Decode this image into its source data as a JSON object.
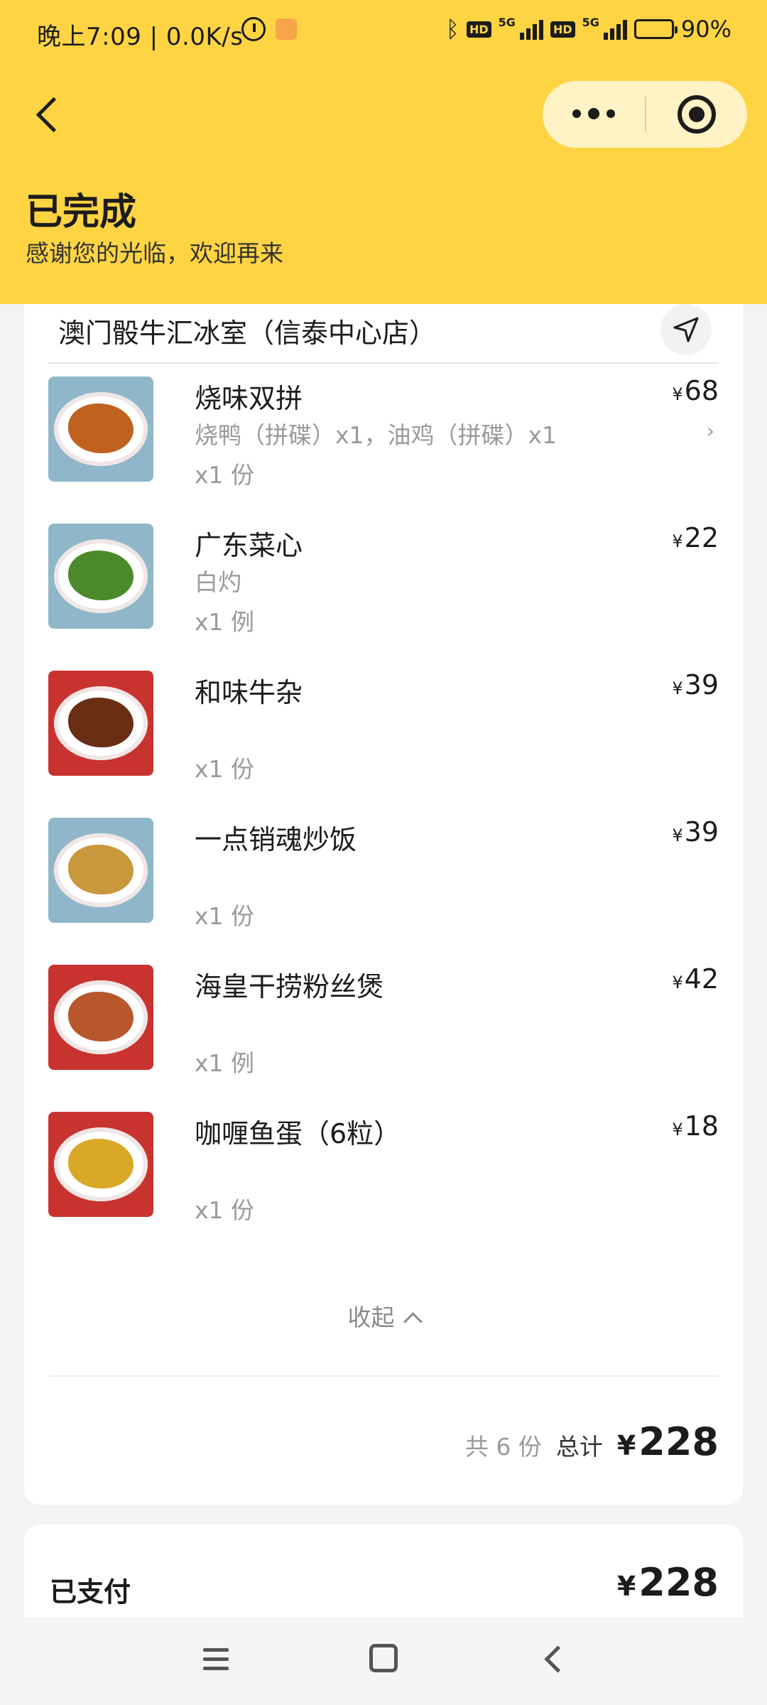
{
  "status_bar": {
    "time_speed": "晚上7:09 | 0.0K/s",
    "hd_badge": "HD",
    "network": "5G",
    "battery_percent": "90%",
    "battery_level": 0.9
  },
  "header": {
    "title": "已完成",
    "subtitle": "感谢您的光临，欢迎再来"
  },
  "order": {
    "shop_name": "澳门骰牛汇冰室（信泰中心店）",
    "currency": "¥",
    "items": [
      {
        "name": "烧味双拼",
        "spec": "烧鸭（拼碟）x1，油鸡（拼碟）x1",
        "qty": "x1 份",
        "price": "68",
        "color": "#c0621f"
      },
      {
        "name": "广东菜心",
        "spec": "白灼",
        "qty": "x1 例",
        "price": "22",
        "color": "#4b8a2c"
      },
      {
        "name": "和味牛杂",
        "spec": "",
        "qty": "x1 份",
        "price": "39",
        "color": "#6a2e14"
      },
      {
        "name": "一点销魂炒饭",
        "spec": "",
        "qty": "x1 份",
        "price": "39",
        "color": "#c9973c"
      },
      {
        "name": "海皇干捞粉丝煲",
        "spec": "",
        "qty": "x1 例",
        "price": "42",
        "color": "#b8562c"
      },
      {
        "name": "咖喱鱼蛋（6粒）",
        "spec": "",
        "qty": "x1 份",
        "price": "18",
        "color": "#d9a826"
      }
    ],
    "collapse_label": "收起",
    "count_label": "共 6 份",
    "total_label": "总计",
    "total": "228"
  },
  "payment": {
    "label": "已支付",
    "amount": "228"
  },
  "colors": {
    "header_bg": "#ffd443",
    "page_bg": "#f3f3f3"
  }
}
